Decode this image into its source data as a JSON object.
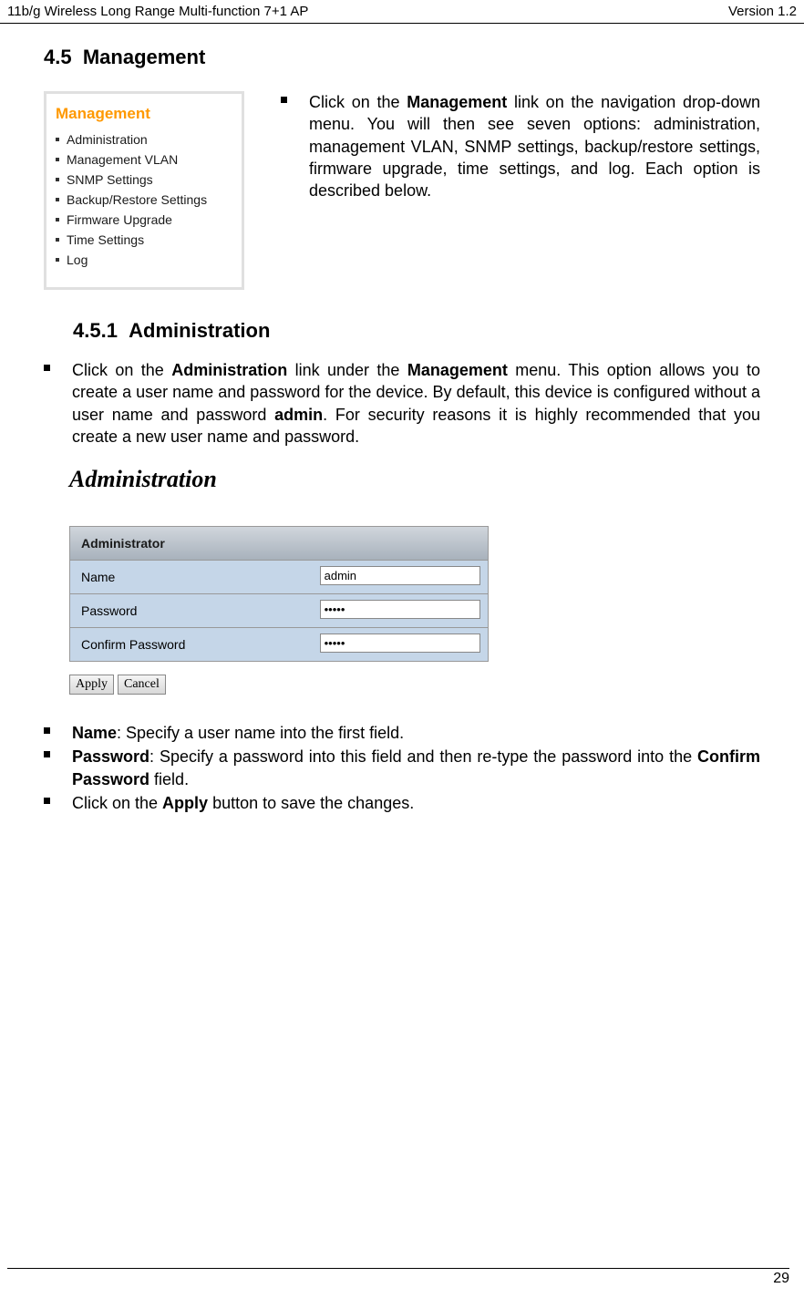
{
  "header": {
    "left": "11b/g Wireless Long Range Multi-function 7+1 AP",
    "right": "Version 1.2"
  },
  "section": {
    "number": "4.5",
    "title": "Management"
  },
  "nav": {
    "title": "Management",
    "items": [
      "Administration",
      "Management VLAN",
      "SNMP Settings",
      "Backup/Restore Settings",
      "Firmware Upgrade",
      "Time Settings",
      "Log"
    ]
  },
  "intro": {
    "prefix": "Click on the ",
    "bold": "Management",
    "suffix": " link on the navigation drop-down menu. You will then see seven options: administration, management VLAN, SNMP settings, backup/restore settings, firmware upgrade, time settings, and log. Each option is described below."
  },
  "subsection": {
    "number": "4.5.1",
    "title": "Administration"
  },
  "admin_intro": {
    "p1": "Click on the ",
    "b1": "Administration",
    "p2": " link under the ",
    "b2": "Management",
    "p3": " menu. This option allows you to create a user name and password for the device. By default, this device is configured without a user name and password ",
    "b3": "admin",
    "p4": ". For security reasons it is highly recommended that you create a new user name and password."
  },
  "admin_form": {
    "heading": "Administration",
    "group_label": "Administrator",
    "rows": {
      "name_label": "Name",
      "name_value": "admin",
      "password_label": "Password",
      "password_value": "•••••",
      "confirm_label": "Confirm Password",
      "confirm_value": "•••••"
    },
    "buttons": {
      "apply": "Apply",
      "cancel": "Cancel"
    }
  },
  "bullets": {
    "name": {
      "b": "Name",
      "t": ": Specify a user name into the first field."
    },
    "password": {
      "b": "Password",
      "t1": ": Specify a password into this field and then re-type the password into the ",
      "b2": "Confirm Password",
      "t2": " field."
    },
    "apply": {
      "t1": "Click on the ",
      "b": "Apply",
      "t2": " button to save the changes."
    }
  },
  "footer": {
    "page": "29"
  }
}
